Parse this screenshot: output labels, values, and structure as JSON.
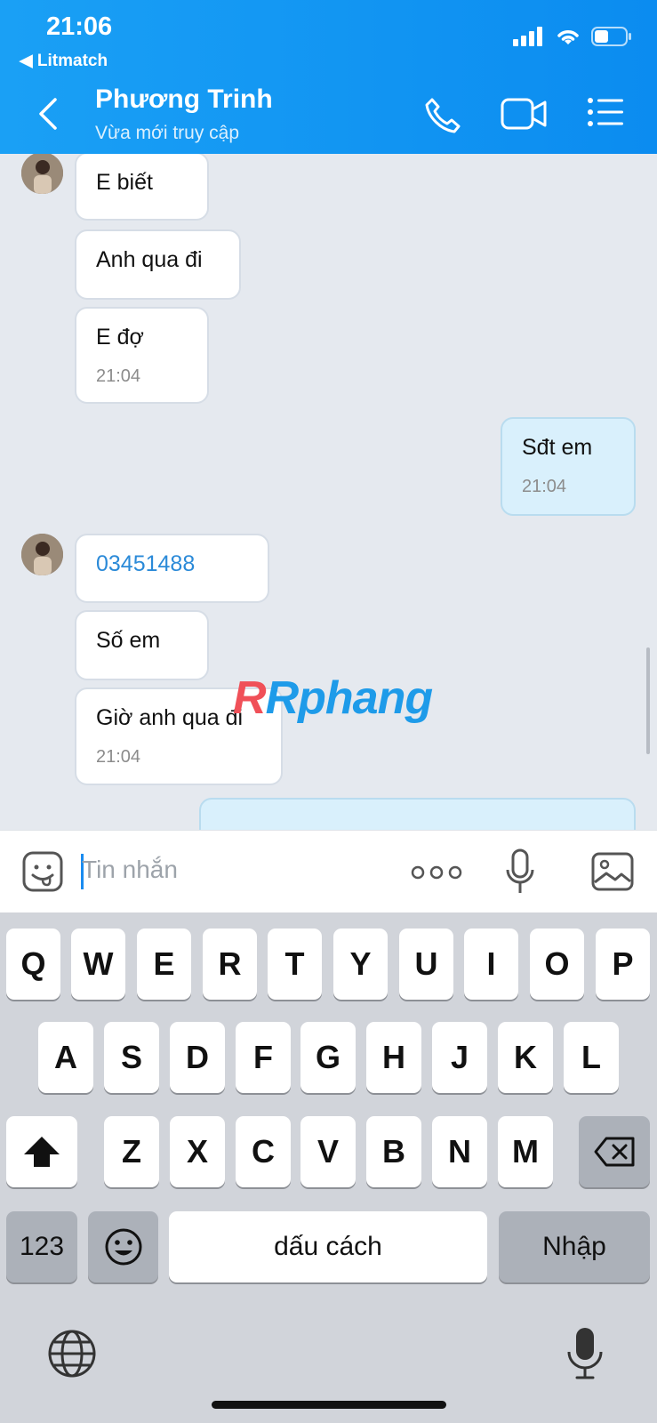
{
  "status_bar": {
    "time": "21:06",
    "back_app": "◀ Litmatch"
  },
  "header": {
    "contact_name": "Phương Trinh",
    "contact_status": "Vừa mới truy cập"
  },
  "messages": [
    {
      "text": "E biết"
    },
    {
      "text": "Anh qua đi"
    },
    {
      "text": "E đợ",
      "time": "21:04"
    },
    {
      "text": "Sđt em",
      "time": "21:04"
    },
    {
      "text": "03451488"
    },
    {
      "text": "Số em"
    },
    {
      "text": "Giờ anh qua đi",
      "time": "21:04"
    }
  ],
  "watermark": "Rphang",
  "composer": {
    "placeholder": "Tin nhắn",
    "more_label": "ooo"
  },
  "keyboard": {
    "row1": [
      "Q",
      "W",
      "E",
      "R",
      "T",
      "Y",
      "U",
      "I",
      "O",
      "P"
    ],
    "row2": [
      "A",
      "S",
      "D",
      "F",
      "G",
      "H",
      "J",
      "K",
      "L"
    ],
    "row3": [
      "Z",
      "X",
      "C",
      "V",
      "B",
      "N",
      "M"
    ],
    "numbers_label": "123",
    "space_label": "dấu cách",
    "return_label": "Nhập"
  },
  "colors": {
    "header": "#0b8cf0",
    "outgoing_bubble": "#d9f0fc",
    "link": "#2b8ad8",
    "chat_bg": "#e5e9ef"
  }
}
